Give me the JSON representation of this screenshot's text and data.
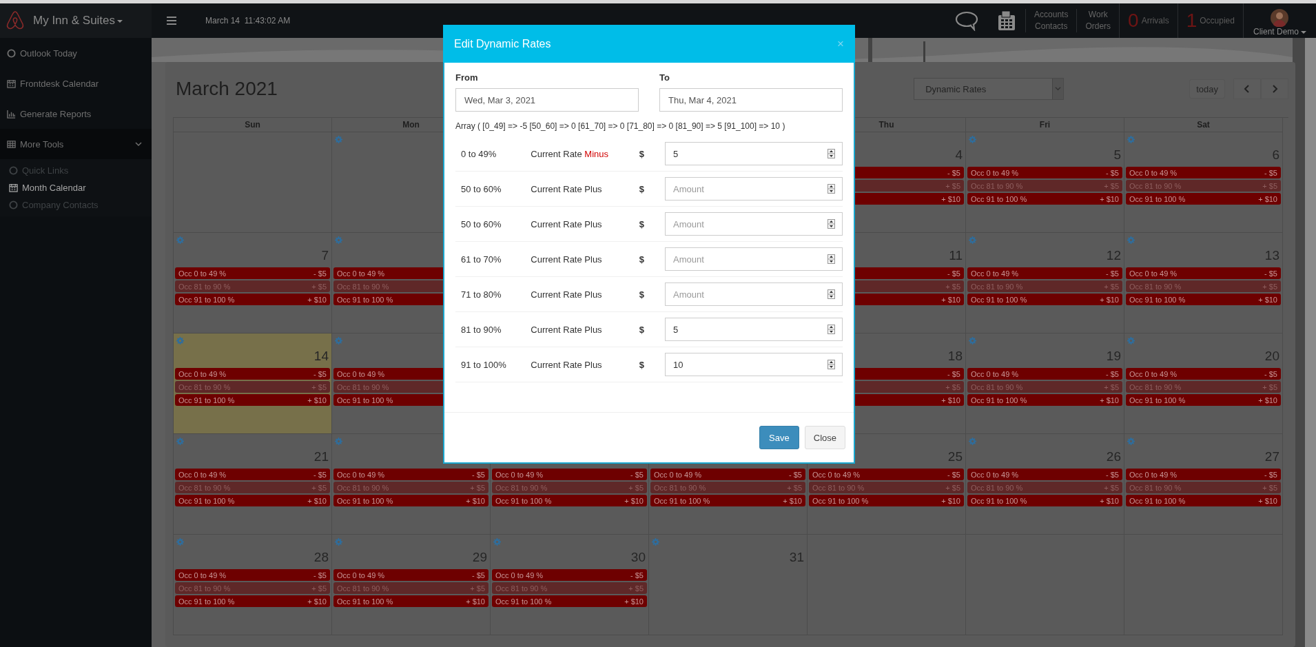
{
  "topbar": {
    "brand": "My Inn & Suites",
    "datetime": "March 14  11:43:02 AM",
    "links": [
      "Accounts Contacts",
      "Work Orders"
    ],
    "counters": [
      {
        "count": "0",
        "label": "Arrivals"
      },
      {
        "count": "1",
        "label": "Occupied"
      }
    ],
    "user": "Client Demo"
  },
  "sidebar": {
    "items": [
      {
        "label": "Outlook Today",
        "selected": false
      },
      {
        "label": "Frontdesk Calendar",
        "selected": false
      },
      {
        "label": "Generate Reports",
        "selected": false
      },
      {
        "label": "More Tools",
        "selected": false,
        "expanded": true,
        "children": [
          {
            "label": "Quick Links",
            "selected": false
          },
          {
            "label": "Month Calendar",
            "selected": true
          },
          {
            "label": "Company Contacts",
            "selected": false
          }
        ]
      }
    ]
  },
  "calendar": {
    "title": "March 2021",
    "view_select": "Dynamic Rates",
    "today_button": "today",
    "weekdays": [
      "Sun",
      "Mon",
      "Thu",
      "Fri",
      "Sat"
    ],
    "weeks": [
      [
        {
          "gear": false,
          "today": false
        },
        {
          "gear": true,
          "today": false
        },
        {
          "gear": false,
          "today": false,
          "day": "4",
          "events": [
            {
              "amount": "- $5",
              "color": "#6e0000"
            },
            {
              "amount": "+ $5",
              "color": "#5f2828"
            },
            {
              "amount": "+ $10",
              "color": "#6e0000"
            }
          ]
        },
        {
          "gear": true,
          "today": false,
          "day": "5",
          "events": [
            {
              "label": "Occ 0 to 49 %",
              "amount": "- $5",
              "color": "#6e0000"
            },
            {
              "label": "Occ 81 to 90 %",
              "amount": "+ $5",
              "color": "#5f2828"
            },
            {
              "label": "Occ 91 to 100 %",
              "amount": "+ $10",
              "color": "#6e0000"
            }
          ]
        },
        {
          "gear": true,
          "today": false,
          "day": "6",
          "events": [
            {
              "label": "Occ 0 to 49 %",
              "amount": "- $5",
              "color": "#6e0000"
            },
            {
              "label": "Occ 81 to 90 %",
              "amount": "+ $5",
              "color": "#5f2828"
            },
            {
              "label": "Occ 91 to 100 %",
              "amount": "+ $10",
              "color": "#6e0000"
            }
          ]
        }
      ],
      [
        {
          "gear": true,
          "today": false,
          "day": "7",
          "events": [
            {
              "label": "Occ 0 to 49 %",
              "amount": "- $5",
              "color": "#6e0000"
            },
            {
              "label": "Occ 81 to 90 %",
              "amount": "+ $5",
              "color": "#5f2828"
            },
            {
              "label": "Occ 91 to 100 %",
              "amount": "+ $10",
              "color": "#6e0000"
            }
          ]
        },
        {
          "gear": true,
          "today": false,
          "events": [
            {
              "label": "Occ 0 to 49 %",
              "color": "#6e0000"
            },
            {
              "label": "Occ 81 to 90 %",
              "color": "#5f2828"
            },
            {
              "label": "Occ 91 to 100 %",
              "color": "#6e0000"
            }
          ]
        },
        {
          "gear": false,
          "today": false,
          "day": "11",
          "events": [
            {
              "amount": "- $5",
              "color": "#6e0000"
            },
            {
              "amount": "+ $5",
              "color": "#5f2828"
            },
            {
              "amount": "+ $10",
              "color": "#6e0000"
            }
          ]
        },
        {
          "gear": true,
          "today": false,
          "day": "12",
          "events": [
            {
              "label": "Occ 0 to 49 %",
              "amount": "- $5",
              "color": "#6e0000"
            },
            {
              "label": "Occ 81 to 90 %",
              "amount": "+ $5",
              "color": "#5f2828"
            },
            {
              "label": "Occ 91 to 100 %",
              "amount": "+ $10",
              "color": "#6e0000"
            }
          ]
        },
        {
          "gear": true,
          "today": false,
          "day": "13",
          "events": [
            {
              "label": "Occ 0 to 49 %",
              "amount": "- $5",
              "color": "#6e0000"
            },
            {
              "label": "Occ 81 to 90 %",
              "amount": "+ $5",
              "color": "#5f2828"
            },
            {
              "label": "Occ 91 to 100 %",
              "amount": "+ $10",
              "color": "#6e0000"
            }
          ]
        }
      ],
      [
        {
          "gear": true,
          "today": true,
          "day": "14",
          "events": [
            {
              "label": "Occ 0 to 49 %",
              "amount": "- $5",
              "color": "#6e0000"
            },
            {
              "label": "Occ 81 to 90 %",
              "amount": "+ $5",
              "color": "#5f2828"
            },
            {
              "label": "Occ 91 to 100 %",
              "amount": "+ $10",
              "color": "#6e0000"
            }
          ]
        },
        {
          "gear": true,
          "today": false,
          "events": [
            {
              "label": "Occ 0 to 49 %",
              "color": "#6e0000"
            },
            {
              "label": "Occ 81 to 90 %",
              "color": "#5f2828"
            },
            {
              "label": "Occ 91 to 100 %",
              "color": "#6e0000"
            }
          ]
        },
        {
          "gear": false,
          "today": false,
          "day": "18",
          "events": [
            {
              "amount": "- $5",
              "color": "#6e0000"
            },
            {
              "amount": "+ $5",
              "color": "#5f2828"
            },
            {
              "amount": "+ $10",
              "color": "#6e0000"
            }
          ]
        },
        {
          "gear": true,
          "today": false,
          "day": "19",
          "events": [
            {
              "label": "Occ 0 to 49 %",
              "amount": "- $5",
              "color": "#6e0000"
            },
            {
              "label": "Occ 81 to 90 %",
              "amount": "+ $5",
              "color": "#5f2828"
            },
            {
              "label": "Occ 91 to 100 %",
              "amount": "+ $10",
              "color": "#6e0000"
            }
          ]
        },
        {
          "gear": true,
          "today": false,
          "day": "20",
          "events": [
            {
              "label": "Occ 0 to 49 %",
              "amount": "- $5",
              "color": "#6e0000"
            },
            {
              "label": "Occ 81 to 90 %",
              "amount": "+ $5",
              "color": "#5f2828"
            },
            {
              "label": "Occ 91 to 100 %",
              "amount": "+ $10",
              "color": "#6e0000"
            }
          ]
        }
      ],
      [
        {
          "gear": true,
          "today": false,
          "day": "21",
          "events": [
            {
              "label": "Occ 0 to 49 %",
              "amount": "- $5",
              "color": "#6e0000"
            },
            {
              "label": "Occ 81 to 90 %",
              "amount": "+ $5",
              "color": "#5f2828"
            },
            {
              "label": "Occ 91 to 100 %",
              "amount": "+ $10",
              "color": "#6e0000"
            }
          ]
        },
        {
          "gear": true,
          "today": false,
          "events": [
            {
              "label": "Occ 0 to 49 %",
              "amount": "- $5",
              "color": "#6e0000"
            },
            {
              "label": "Occ 81 to 90 %",
              "amount": "+ $5",
              "color": "#5f2828"
            },
            {
              "label": "Occ 91 to 100 %",
              "amount": "+ $10",
              "color": "#6e0000"
            }
          ]
        },
        {
          "gear": false,
          "today": false,
          "events": [
            {
              "label": "Occ 0 to 49 %",
              "amount": "- $5",
              "color": "#6e0000"
            },
            {
              "label": "Occ 81 to 90 %",
              "amount": "+ $5",
              "color": "#5f2828"
            },
            {
              "label": "Occ 91 to 100 %",
              "amount": "+ $10",
              "color": "#6e0000"
            }
          ]
        },
        {
          "gear": false,
          "today": false,
          "events": [
            {
              "label": "Occ 0 to 49 %",
              "amount": "- $5",
              "color": "#6e0000"
            },
            {
              "label": "Occ 81 to 90 %",
              "amount": "+ $5",
              "color": "#5f2828"
            },
            {
              "label": "Occ 91 to 100 %",
              "amount": "+ $10",
              "color": "#6e0000"
            }
          ]
        },
        {
          "gear": false,
          "today": false,
          "day": "25",
          "events": [
            {
              "label": "Occ 0 to 49 %",
              "amount": "- $5",
              "color": "#6e0000"
            },
            {
              "label": "Occ 81 to 90 %",
              "amount": "+ $5",
              "color": "#5f2828"
            },
            {
              "label": "Occ 91 to 100 %",
              "amount": "+ $10",
              "color": "#6e0000"
            }
          ]
        },
        {
          "gear": true,
          "today": false,
          "day": "26",
          "events": [
            {
              "label": "Occ 0 to 49 %",
              "amount": "- $5",
              "color": "#6e0000"
            },
            {
              "label": "Occ 81 to 90 %",
              "amount": "+ $5",
              "color": "#5f2828"
            },
            {
              "label": "Occ 91 to 100 %",
              "amount": "+ $10",
              "color": "#6e0000"
            }
          ]
        },
        {
          "gear": true,
          "today": false,
          "day": "27",
          "events": [
            {
              "label": "Occ 0 to 49 %",
              "amount": "- $5",
              "color": "#6e0000"
            },
            {
              "label": "Occ 81 to 90 %",
              "amount": "+ $5",
              "color": "#5f2828"
            },
            {
              "label": "Occ 91 to 100 %",
              "amount": "+ $10",
              "color": "#6e0000"
            }
          ]
        }
      ],
      [
        {
          "gear": true,
          "today": false,
          "day": "28",
          "events": [
            {
              "label": "Occ 0 to 49 %",
              "amount": "- $5",
              "color": "#6e0000"
            },
            {
              "label": "Occ 81 to 90 %",
              "amount": "+ $5",
              "color": "#5f2828"
            },
            {
              "label": "Occ 91 to 100 %",
              "amount": "+ $10",
              "color": "#6e0000"
            }
          ]
        },
        {
          "gear": true,
          "today": false,
          "day": "29",
          "events": [
            {
              "label": "Occ 0 to 49 %",
              "amount": "- $5",
              "color": "#6e0000"
            },
            {
              "label": "Occ 81 to 90 %",
              "amount": "+ $5",
              "color": "#5f2828"
            },
            {
              "label": "Occ 91 to 100 %",
              "amount": "+ $10",
              "color": "#6e0000"
            }
          ]
        },
        {
          "gear": true,
          "today": false,
          "day": "30",
          "events": [
            {
              "label": "Occ 0 to 49 %",
              "amount": "- $5",
              "color": "#6e0000"
            },
            {
              "label": "Occ 81 to 90 %",
              "amount": "+ $5",
              "color": "#5f2828"
            },
            {
              "label": "Occ 91 to 100 %",
              "amount": "+ $10",
              "color": "#6e0000"
            }
          ]
        },
        {
          "gear": true,
          "today": false,
          "day": "31"
        },
        {
          "gear": false,
          "today": false
        },
        {
          "gear": false,
          "today": false
        },
        {
          "gear": false,
          "today": false
        }
      ]
    ]
  },
  "modal": {
    "title": "Edit Dynamic Rates",
    "close_glyph": "×",
    "from": {
      "label": "From",
      "value": "Wed, Mar 3, 2021"
    },
    "to": {
      "label": "To",
      "value": "Thu, Mar 4, 2021"
    },
    "array_text": "Array ( [0_49] => -5 [50_60] => 0 [61_70] => 0 [71_80] => 0 [81_90] => 5 [91_100] => 10 )",
    "rates": [
      {
        "range": "0 to 49%",
        "label": "Current Rate",
        "operator": "Minus",
        "negative": true,
        "currency": "$",
        "value": "5"
      },
      {
        "range": "50 to 60%",
        "label": "Current Rate",
        "operator": "Plus",
        "negative": false,
        "currency": "$",
        "placeholder": "Amount"
      },
      {
        "range": "50 to 60%",
        "label": "Current Rate",
        "operator": "Plus",
        "negative": false,
        "currency": "$",
        "placeholder": "Amount"
      },
      {
        "range": "61 to 70%",
        "label": "Current Rate",
        "operator": "Plus",
        "negative": false,
        "currency": "$",
        "placeholder": "Amount"
      },
      {
        "range": "71 to 80%",
        "label": "Current Rate",
        "operator": "Plus",
        "negative": false,
        "currency": "$",
        "placeholder": "Amount"
      },
      {
        "range": "81 to 90%",
        "label": "Current Rate",
        "operator": "Plus",
        "negative": false,
        "currency": "$",
        "value": "5"
      },
      {
        "range": "91 to 100%",
        "label": "Current Rate",
        "operator": "Plus",
        "negative": false,
        "currency": "$",
        "value": "10"
      }
    ],
    "buttons": [
      {
        "label": "Save",
        "kind": "primary"
      },
      {
        "label": "Close",
        "kind": "default"
      }
    ]
  }
}
